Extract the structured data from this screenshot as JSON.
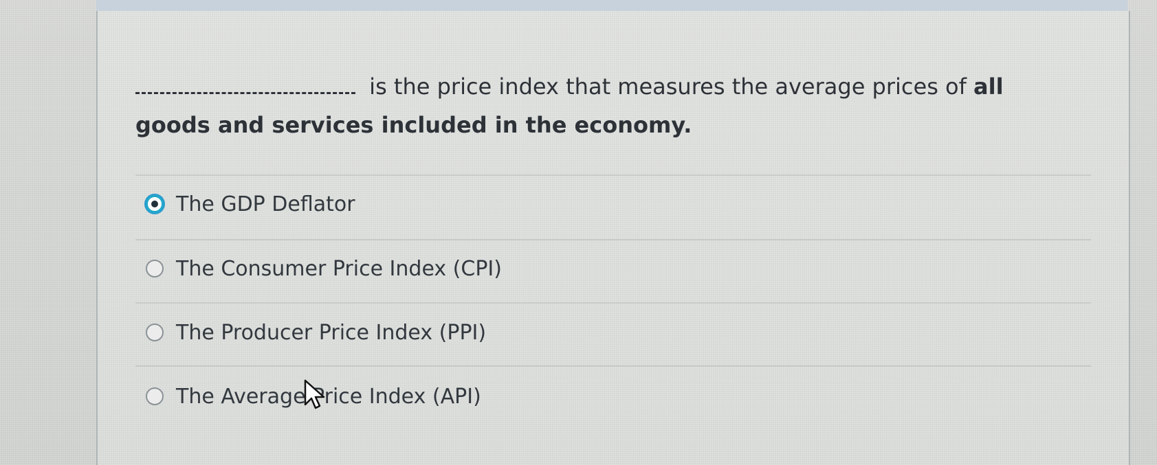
{
  "question": {
    "blank": "_________________",
    "text_line1": "is the price index that measures the average prices of",
    "text_bold_word": "all",
    "text_line2": "goods and services included in the economy."
  },
  "options": [
    {
      "label": "The GDP Deflator",
      "selected": true
    },
    {
      "label": "The Consumer Price Index (CPI)",
      "selected": false
    },
    {
      "label": "The Producer Price Index (PPI)",
      "selected": false
    },
    {
      "label": "The Average Price Index (API)",
      "selected": false
    }
  ],
  "colors": {
    "selected_radio": "#24a8c9",
    "text": "#32383e"
  },
  "icons": {
    "cursor": "arrow-cursor-icon"
  }
}
